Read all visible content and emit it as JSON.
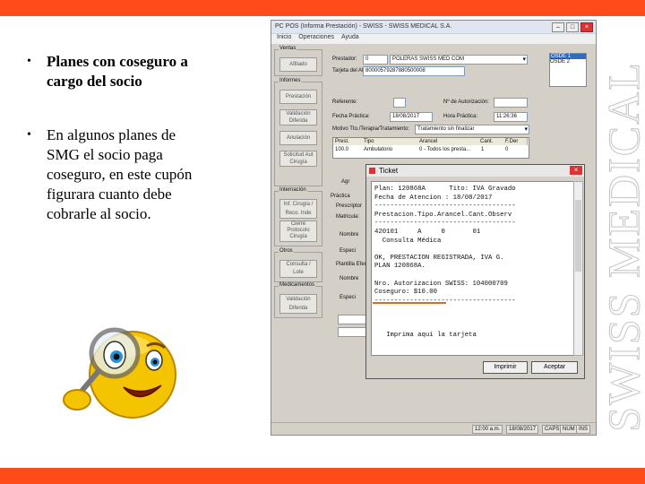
{
  "bullets": [
    {
      "text": "Planes con coseguro a\ncargo del socio"
    },
    {
      "text": "En algunos planes de\nSMG el socio paga\ncoseguro, en este cupón\nfigurara cuanto debe\ncobrarle al socio."
    }
  ],
  "brand": "SWISS MEDICAL",
  "app": {
    "title": "PC POS (Informa Prestación) - SWISS - SWISS MEDICAL S.A.",
    "menu": [
      "Inicio",
      "Operaciones",
      "Ayuda"
    ],
    "left_groups": {
      "g1": "Ventas",
      "g2": "Informes",
      "g3": "Internación",
      "g4": "Otros",
      "g5": "Medicamentos"
    },
    "left_buttons": [
      "Afiliado",
      "Prestación",
      "Validación Diferida",
      "Anulación",
      "Solicitud Aut Cirugía",
      "Inf. Cirugía / Reco. Inde",
      "Cierre Protocolo Cirugía",
      "Consulta / Lote",
      "Validación Diferida"
    ],
    "form": {
      "prestador_label": "Prestador:",
      "prestador_value": "0",
      "prestador_name": "POLERAS SWISS MED COM",
      "afiliado_label": "Tarjeta del Afiliado:",
      "afiliado_value": "80000579287880500008",
      "referente_label": "Referente:",
      "autorizacion_label": "Nº de Autorización:",
      "fecha_label": "Fecha Práctica:",
      "fecha_value": "18/08/2017",
      "hora_label": "Hora Práctica:",
      "hora_value": "11:26:36",
      "motivo_label": "Motivo Tto./Terapia/Tratamiento:",
      "motivo_value": "Tratamiento sin finalizar"
    },
    "grid": {
      "headers": [
        "Prest.",
        "Tipo",
        "Arancel",
        "Cant.",
        "F.Der"
      ],
      "row": [
        "100.0",
        "Ambulatorio",
        "0 - Todos los presta...",
        "1",
        "0"
      ]
    },
    "side_labels": [
      "Agr",
      "Práctica",
      "Matricula:",
      "Nombre",
      "Especi",
      "Nombre",
      "Especi",
      "Matricula:",
      "Nombre",
      "Especi"
    ],
    "section_labels": [
      "Prescriptor",
      "Plantilla Efectora"
    ],
    "right_list": [
      "OSDE 1",
      "OSDE 2"
    ],
    "status": [
      "12:00 a.m.",
      "18/08/2017",
      "CAPS",
      "NUM",
      "INS"
    ]
  },
  "ticket": {
    "title": "Ticket",
    "lines": [
      "Plan: 120868A      Tito: IVA Gravado",
      "Fecha de Atencion : 18/08/2017",
      "------------------------------------",
      "Prestacion.Tipo.Arancel.Cant.Observ",
      "------------------------------------",
      "420101     A     0       01",
      "  Consulta Médica",
      "",
      "OK, PRESTACION REGISTRADA, IVA G.",
      "PLAN 120868A.",
      "",
      "Nro. Autorizacion SWISS: 104000709",
      "Coseguro: $10.00",
      "------------------------------------",
      "",
      "",
      "",
      "   Imprima aqui la tarjeta"
    ],
    "btn_print": "Imprimir",
    "btn_accept": "Aceptar"
  }
}
